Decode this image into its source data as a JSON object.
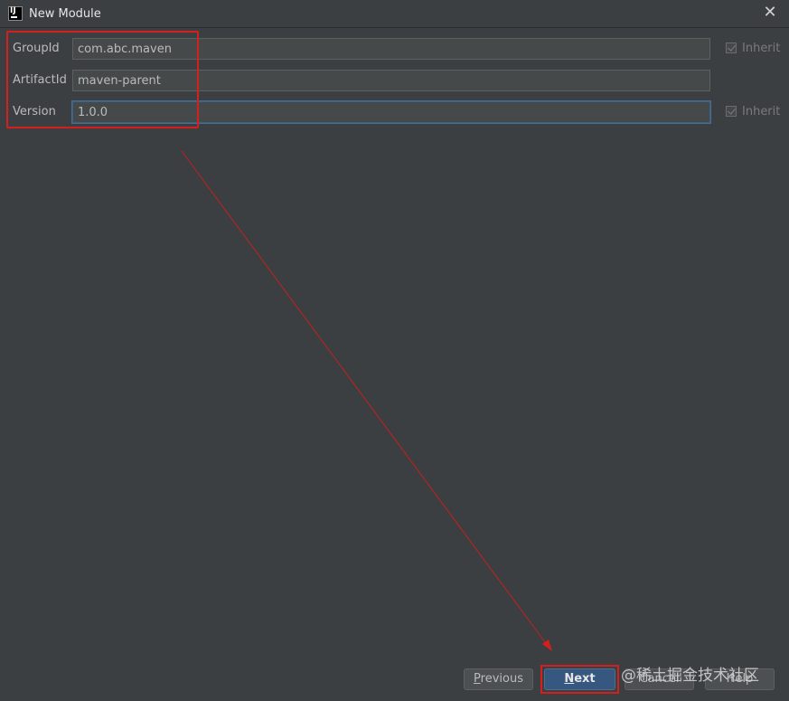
{
  "window": {
    "title": "New Module",
    "close_icon": "close-icon",
    "app_icon": "intellij-icon",
    "app_icon_text": "IJ"
  },
  "form": {
    "group_id": {
      "label": "GroupId",
      "value": "com.abc.maven",
      "inherit_label": "Inherit",
      "inherit_checked": true,
      "inherit_enabled": false
    },
    "artifact_id": {
      "label": "ArtifactId",
      "value": "maven-parent"
    },
    "version": {
      "label": "Version",
      "value": "1.0.0",
      "inherit_label": "Inherit",
      "inherit_checked": true,
      "inherit_enabled": false
    }
  },
  "buttons": {
    "previous": {
      "mnemonic": "P",
      "rest": "revious"
    },
    "next": {
      "mnemonic": "N",
      "rest": "ext"
    },
    "cancel": "Cancel",
    "help": "Help"
  },
  "annotation": {
    "color": "#d51f1f"
  },
  "watermark": "@稀土掘金技术社区",
  "colors": {
    "background": "#3c3f41",
    "field_background": "#45494a",
    "default_button": "#365880",
    "focus_border": "#466d94"
  }
}
